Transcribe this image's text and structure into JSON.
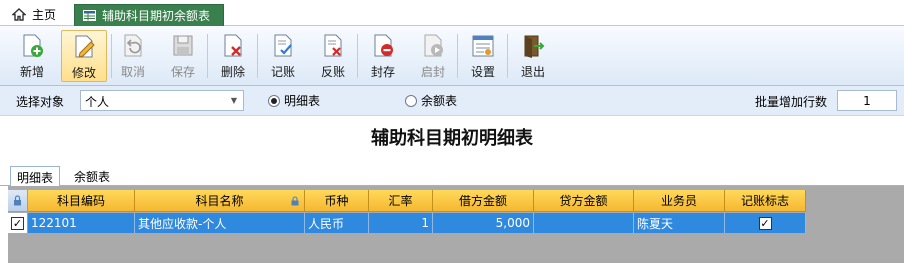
{
  "tabs": {
    "home_label": "主页",
    "active_label": "辅助科目期初余额表"
  },
  "toolbar": {
    "buttons": [
      {
        "label": "新增",
        "icon": "add-doc-icon"
      },
      {
        "label": "修改",
        "icon": "edit-icon"
      },
      {
        "label": "取消",
        "icon": "undo-icon"
      },
      {
        "label": "保存",
        "icon": "save-icon"
      },
      {
        "label": "删除",
        "icon": "delete-icon"
      },
      {
        "label": "记账",
        "icon": "post-icon"
      },
      {
        "label": "反账",
        "icon": "unpost-icon"
      },
      {
        "label": "封存",
        "icon": "seal-icon"
      },
      {
        "label": "启封",
        "icon": "unseal-icon"
      },
      {
        "label": "设置",
        "icon": "settings-icon"
      },
      {
        "label": "退出",
        "icon": "exit-icon"
      }
    ]
  },
  "filter": {
    "object_label": "选择对象",
    "object_value": "个人",
    "radio_detail": "明细表",
    "radio_balance": "余额表",
    "batch_label": "批量增加行数",
    "batch_value": "1"
  },
  "title": "辅助科目期初明细表",
  "subtabs": [
    "明细表",
    "余额表"
  ],
  "grid": {
    "columns": [
      "科目编码",
      "科目名称",
      "币种",
      "汇率",
      "借方金额",
      "贷方金额",
      "业务员",
      "记账标志"
    ],
    "rows": [
      {
        "code": "122101",
        "name": "其他应收款-个人",
        "currency": "人民币",
        "rate": "1",
        "debit": "5,000",
        "credit": "",
        "clerk": "陈夏天",
        "posted": "✓",
        "selected": "✓"
      }
    ]
  }
}
